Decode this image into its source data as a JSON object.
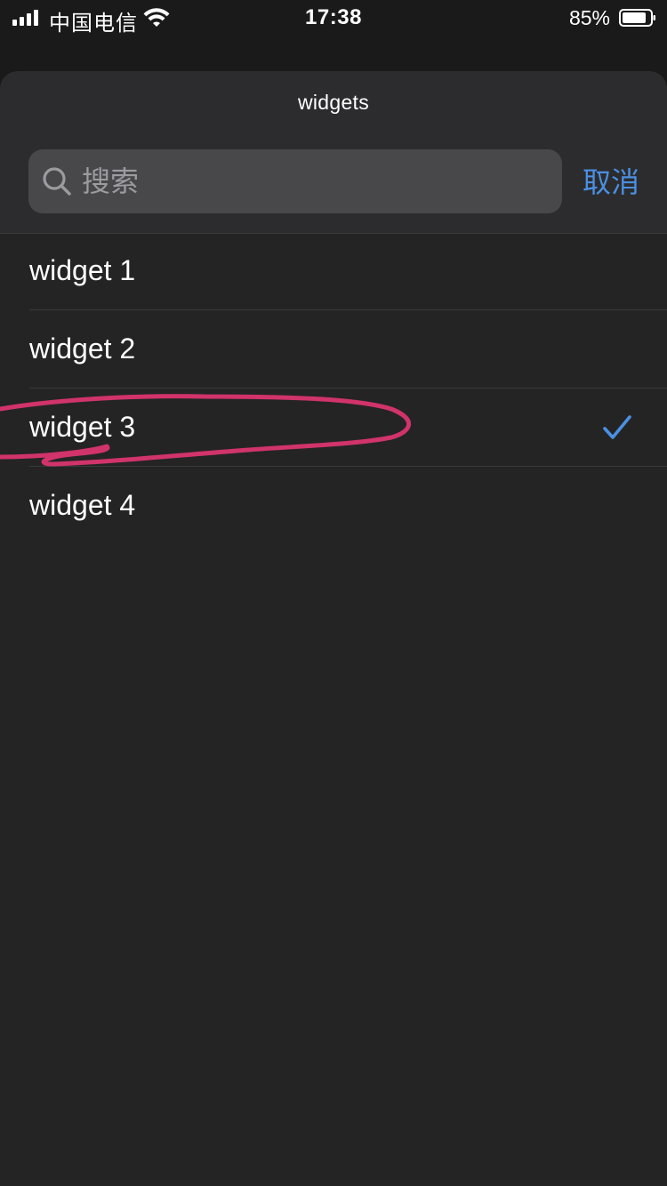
{
  "status_bar": {
    "carrier": "中国电信",
    "time": "17:38",
    "battery_percent": "85%",
    "signal_icon": "cellular-signal-icon",
    "wifi_icon": "wifi-icon",
    "battery_icon": "battery-icon"
  },
  "sheet": {
    "title": "widgets",
    "search": {
      "placeholder": "搜索",
      "value": "",
      "icon": "search-icon"
    },
    "cancel_label": "取消"
  },
  "list": {
    "items": [
      {
        "label": "widget 1",
        "selected": false
      },
      {
        "label": "widget 2",
        "selected": false
      },
      {
        "label": "widget 3",
        "selected": true
      },
      {
        "label": "widget 4",
        "selected": false
      }
    ],
    "check_icon": "checkmark-icon"
  },
  "colors": {
    "accent": "#4a90e2",
    "annotation": "#d1336b",
    "background": "#242424"
  }
}
